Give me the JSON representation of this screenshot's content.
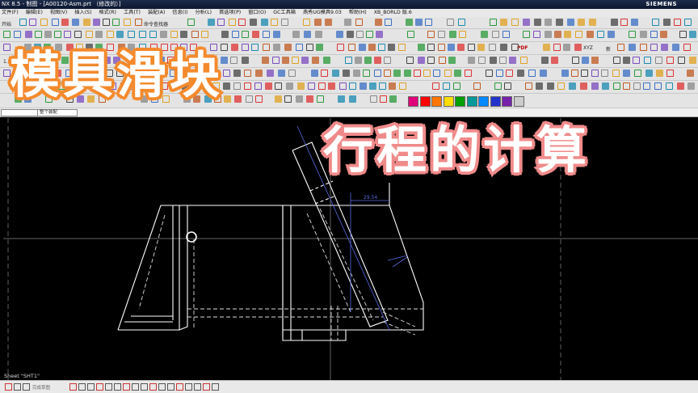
{
  "window": {
    "title": "NX 8.5 - 制图 - [A00120-Asm.prt （修改的）]",
    "brand": "SIEMENS"
  },
  "menu": [
    "文件(F)",
    "编辑(E)",
    "视图(V)",
    "插入(S)",
    "格式(R)",
    "工具(T)",
    "装配(A)",
    "信息(I)",
    "分析(L)",
    "首选项(P)",
    "窗口(O)",
    "GC工具箱",
    "燕秀UG模具9.03",
    "帮助(H)",
    "XB_BORLD 版.6"
  ],
  "toolbar": {
    "start_label": "开始",
    "command_finder_label": "命令查找器",
    "zoom_value": "1.00",
    "text_btn": "A",
    "pdf_label": "PDF",
    "new_label": "新",
    "xyz_label": "XYZ"
  },
  "cmdrow": {
    "filter_select": "",
    "assembly_select": "整个装配"
  },
  "palette": [
    "#e0007a",
    "#ff0000",
    "#ff7700",
    "#ffdd00",
    "#00a000",
    "#009999",
    "#0088ff",
    "#2233cc",
    "#7722aa",
    "#cccccc"
  ],
  "drawing": {
    "dimension_value": "29.54"
  },
  "overlay": {
    "title_main": "模具滑块",
    "title_sub": "行程的计算"
  },
  "status": {
    "sheet": "Sheet \"SHT1\"",
    "bottom_label": "完成草图"
  },
  "colors": {
    "title_main_stroke": "#f48a2d",
    "title_sub_stroke": "#f08a8a",
    "drawing_line": "#ffffff",
    "dimension": "#5a6ae0"
  }
}
